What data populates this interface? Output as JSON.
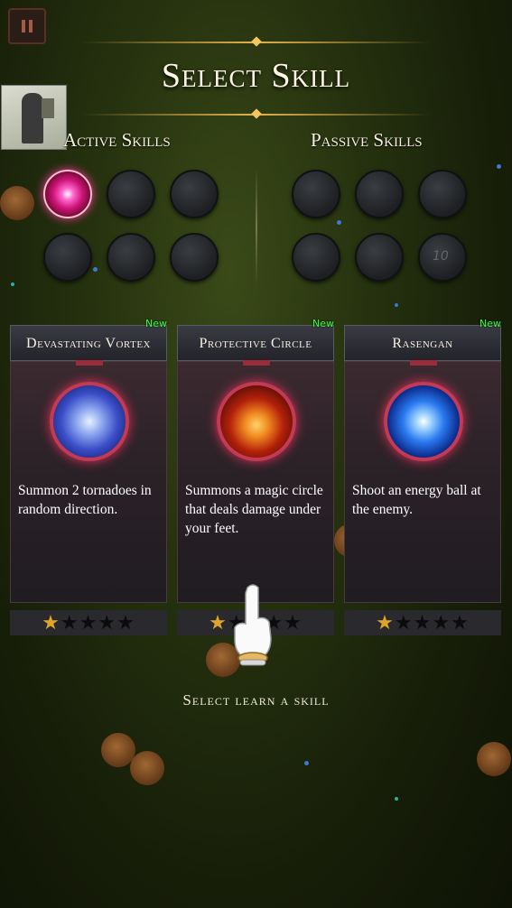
{
  "title": "Select Skill",
  "active_label": "Active Skills",
  "passive_label": "Passive Skills",
  "passive_slot_number": "10",
  "cards": [
    {
      "name": "Devastating Vortex",
      "badge": "New",
      "description": "Summon 2 tornadoes in random direction.",
      "icon": "vortex-icon",
      "rating": 1,
      "max_rating": 5
    },
    {
      "name": "Protective Circle",
      "badge": "New",
      "description": "Summons a magic circle that deals damage under your feet.",
      "icon": "magic-circle-icon",
      "rating": 1,
      "max_rating": 5
    },
    {
      "name": "Rasengan",
      "badge": "New",
      "description": "Shoot an energy ball at the enemy.",
      "icon": "energy-ball-icon",
      "rating": 1,
      "max_rating": 5
    }
  ],
  "footer": "Select learn a skill",
  "colors": {
    "accent_gold": "#e8b04a",
    "new_badge": "#3cff3c",
    "icon_ring": "#c33a55",
    "star_on": "#e0a42a"
  }
}
